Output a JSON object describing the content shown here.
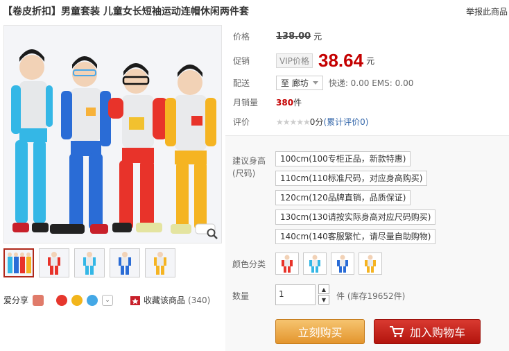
{
  "header": {
    "title": "【卷皮折扣】男童套装 儿童女长短袖运动连帽休闲两件套",
    "report_link": "举报此商品"
  },
  "gallery": {
    "thumbnail_count": 5
  },
  "share": {
    "label": "爱分享",
    "favorite_label": "收藏该商品",
    "favorite_count": "(340)"
  },
  "info": {
    "price_label": "价格",
    "original_price": "138.00",
    "currency_unit": "元",
    "promo_label": "促销",
    "vip_badge": "VIP价格",
    "promo_price": "38.64",
    "shipping_label": "配送",
    "shipping_dest": "至 廊坊",
    "shipping_detail": "快递: 0.00 EMS: 0.00",
    "monthly_sales_label": "月销量",
    "monthly_sales": "380",
    "sales_unit": "件",
    "review_label": "评价",
    "rating_stars": "★★★★★",
    "rating_score": "0分",
    "review_link": "(累计评价0)"
  },
  "options": {
    "size_label_1": "建议身高",
    "size_label_2": "(尺码)",
    "sizes": [
      "100cm(100专柜正品，新款特惠)",
      "110cm(110标准尺码，对应身高购买)",
      "120cm(120品牌直销，品质保证)",
      "130cm(130请按实际身高对应尺码购买)",
      "140cm(140客服繁忙，请尽量自助购物)"
    ],
    "color_label": "颜色分类",
    "color_count": 4,
    "quantity_label": "数量",
    "quantity_value": "1",
    "stock_text": "件 (库存19652件)",
    "buy_now": "立刻购买",
    "add_to_cart": "加入购物车"
  },
  "colors": {
    "price_red": "#c40000",
    "buy_orange": "#e3952d",
    "cart_red": "#b3140d"
  }
}
